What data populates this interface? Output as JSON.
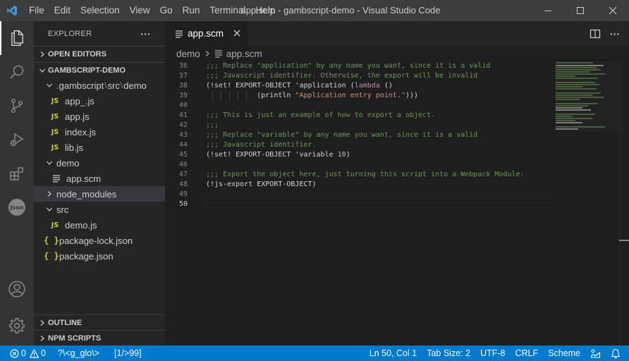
{
  "window": {
    "title": "app.scm - gambscript-demo - Visual Studio Code",
    "menu": [
      "File",
      "Edit",
      "Selection",
      "View",
      "Go",
      "Run",
      "Terminal",
      "Help"
    ]
  },
  "activity_bar": [
    "files-icon",
    "search-icon",
    "source-control-icon",
    "run-debug-icon",
    "extensions-icon",
    "json-icon",
    "account-icon",
    "settings-gear-icon"
  ],
  "json_badge": "Json",
  "sidebar": {
    "title": "EXPLORER",
    "more": "···",
    "open_editors": "OPEN EDITORS",
    "project": "GAMBSCRIPT-DEMO",
    "tree": {
      "gambscript_folder": [
        ".gambscript",
        "src",
        "demo"
      ],
      "gambscript_files": [
        "app_.js",
        "app.js",
        "index.js",
        "lib.js"
      ],
      "demo_folder": "demo",
      "demo_files": [
        "app.scm"
      ],
      "node_modules": "node_modules",
      "src_folder": "src",
      "src_files": [
        "demo.js"
      ],
      "root_files": [
        "package-lock.json",
        "package.json"
      ],
      "js_badge": "JS",
      "json_badge": "{ }"
    },
    "outline": "OUTLINE",
    "npm_scripts": "NPM SCRIPTS"
  },
  "editor": {
    "tab_label": "app.scm",
    "breadcrumb": [
      "demo",
      "app.scm"
    ],
    "lines": [
      {
        "n": "36",
        "t": [
          {
            "c": "c-com",
            "s": ";;; Replace \"application\" by any name you want, since it is a valid"
          }
        ]
      },
      {
        "n": "37",
        "t": [
          {
            "c": "c-com",
            "s": ";;; Javascript identifier. Otherwise, the export will be invalid"
          }
        ]
      },
      {
        "n": "38",
        "t": [
          {
            "c": "c-def",
            "s": "(!set! EXPORT-OBJECT 'application ("
          },
          {
            "c": "c-kw",
            "s": "lambda"
          },
          {
            "c": "c-def",
            "s": " ()"
          }
        ]
      },
      {
        "n": "39",
        "t": [
          {
            "c": "c-def",
            "s": "            (println "
          },
          {
            "c": "c-str",
            "s": "\"Application entry point.\""
          },
          {
            "c": "c-def",
            "s": ")))"
          }
        ]
      },
      {
        "n": "40",
        "t": []
      },
      {
        "n": "41",
        "t": [
          {
            "c": "c-com",
            "s": ";;; This is just an example of how to export a object."
          }
        ]
      },
      {
        "n": "42",
        "t": [
          {
            "c": "c-com",
            "s": ";;;"
          }
        ]
      },
      {
        "n": "43",
        "t": [
          {
            "c": "c-com",
            "s": ";;; Replace \"variable\" by any name you want, since it is a valid"
          }
        ]
      },
      {
        "n": "44",
        "t": [
          {
            "c": "c-com",
            "s": ";;; Javascript identifier."
          }
        ]
      },
      {
        "n": "45",
        "t": [
          {
            "c": "c-def",
            "s": "(!set! EXPORT-OBJECT 'variable "
          },
          {
            "c": "c-num",
            "s": "10"
          },
          {
            "c": "c-def",
            "s": ")"
          }
        ]
      },
      {
        "n": "46",
        "t": []
      },
      {
        "n": "47",
        "t": [
          {
            "c": "c-com",
            "s": ";;; Export the object here, just turning this script into a Webpack Module:"
          }
        ]
      },
      {
        "n": "48",
        "t": [
          {
            "c": "c-def",
            "s": "(!js-export EXPORT-OBJECT)"
          }
        ]
      },
      {
        "n": "49",
        "t": []
      },
      {
        "n": "50",
        "t": []
      }
    ],
    "current_line": "50"
  },
  "status": {
    "errors": "0",
    "warnings": "0",
    "vim_mode": "?\\<g_glo\\>",
    "match": "[1/>99]",
    "position": "Ln 50, Col 1",
    "tab_size": "Tab Size: 2",
    "encoding": "UTF-8",
    "eol": "CRLF",
    "language": "Scheme"
  },
  "colors": {
    "status_bar": "#007acc",
    "activity_bar": "#333333",
    "sidebar": "#252526",
    "editor": "#1e1e1e",
    "comment": "#6a9955",
    "string": "#ce9178",
    "keyword": "#c586c0",
    "number": "#b5cea8",
    "js_icon": "#cbcb41"
  }
}
